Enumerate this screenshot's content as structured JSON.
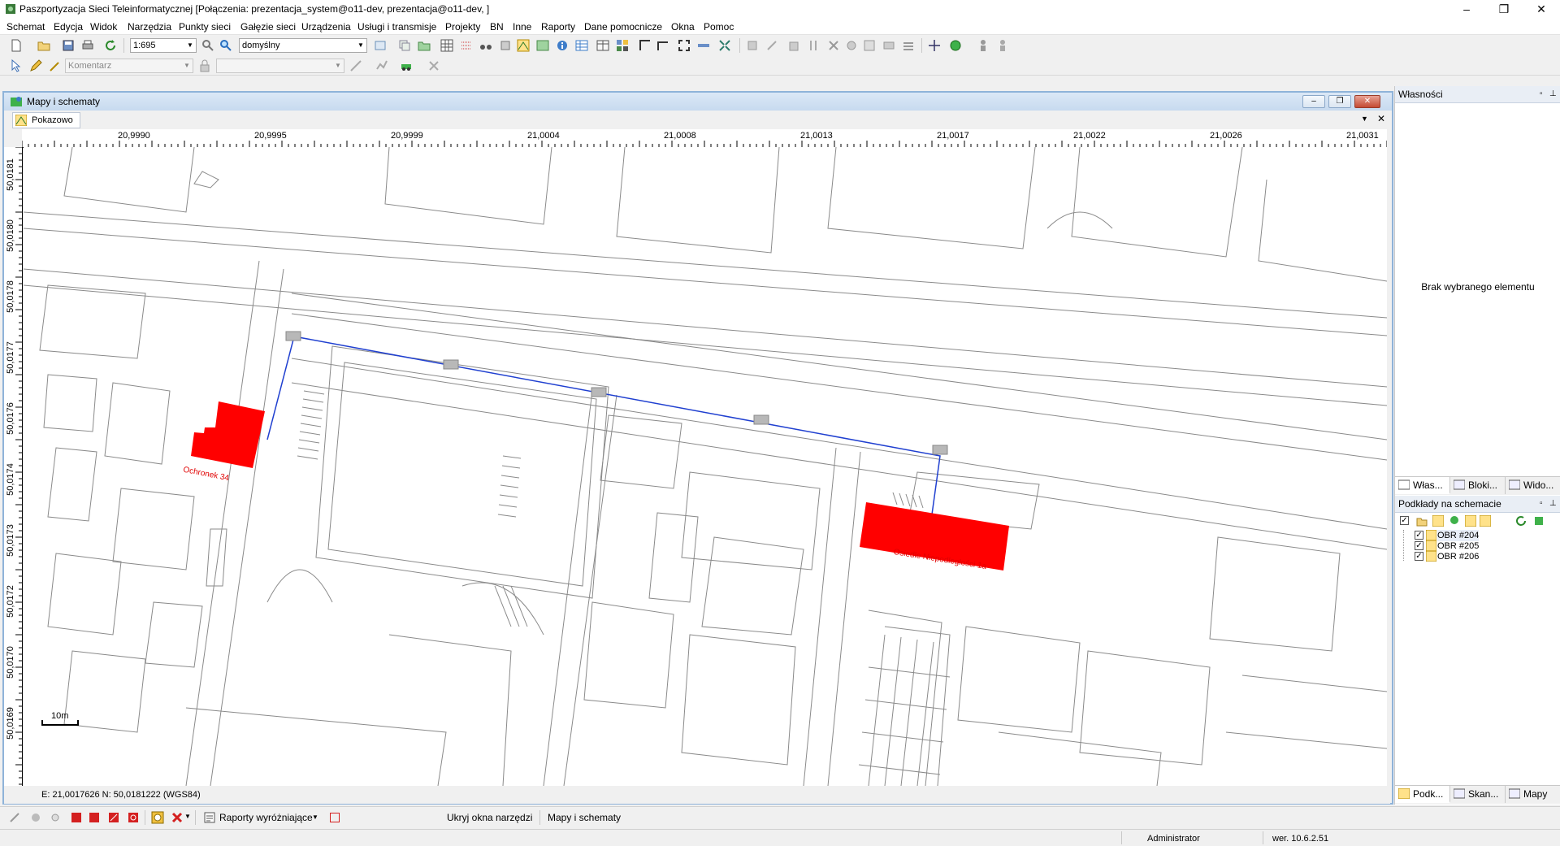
{
  "app": {
    "title": "Paszportyzacja Sieci Teleinformatycznej [Połączenia: prezentacja_system@o11-dev, prezentacja@o11-dev, ]"
  },
  "menu": [
    "Schemat",
    "Edycja",
    "Widok",
    "Narzędzia",
    "Punkty sieci",
    "Gałęzie sieci",
    "Urządzenia",
    "Usługi i transmisje",
    "Projekty",
    "BN",
    "Inne",
    "Raporty",
    "Dane pomocnicze",
    "Okna",
    "Pomoc"
  ],
  "toolbar": {
    "scale": "1:695",
    "style": "domyślny",
    "comment_placeholder": "Komentarz"
  },
  "mdi": {
    "title": "Mapy i schematy",
    "tab": "Pokazowo"
  },
  "ruler": {
    "x_labels": [
      "20,9990",
      "20,9995",
      "20,9999",
      "21,0004",
      "21,0008",
      "21,0013",
      "21,0017",
      "21,0022",
      "21,0026",
      "21,0031"
    ],
    "y_labels": [
      "50,0181",
      "50,0180",
      "50,0178",
      "50,0177",
      "50,0176",
      "50,0174",
      "50,0173",
      "50,0172",
      "50,0170",
      "50,0169"
    ]
  },
  "map": {
    "scale_bar": "10m",
    "labels": [
      "Ochronek 34",
      "Osiedle Niepodległości 1a"
    ],
    "highlight_color": "#ff0000",
    "route_color": "#2040d0",
    "coords": "E: 21,0017626  N: 50,0181222 (WGS84)"
  },
  "right_panel": {
    "properties_title": "Własności",
    "no_selection": "Brak wybranego elementu",
    "top_tabs": [
      "Włas...",
      "Bloki...",
      "Wido..."
    ],
    "layers_title": "Podkłady na schemacie",
    "layers": [
      "OBR #204",
      "OBR #205",
      "OBR #206"
    ],
    "bottom_tabs": [
      "Podk...",
      "Skan...",
      "Mapy"
    ]
  },
  "bottombar": {
    "reports": "Raporty wyróżniające",
    "hide_tools": "Ukryj okna narzędzi",
    "maps": "Mapy i schematy"
  },
  "status": {
    "user": "Administrator",
    "version": "wer. 10.6.2.51"
  }
}
